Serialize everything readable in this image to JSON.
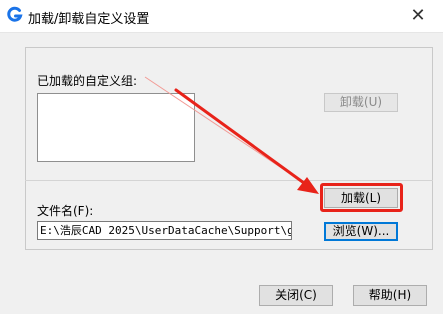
{
  "window": {
    "title": "加载/卸载自定义设置",
    "close_glyph": "✕",
    "icon": "app-logo-icon",
    "accent_color": "#1a73e8"
  },
  "groups": {
    "loaded_label": "已加载的自定义组:",
    "unload_button": "卸载(U)",
    "load_button": "加载(L)",
    "filename_label": "文件名(F):",
    "filename_value": "E:\\浩辰CAD 2025\\UserDataCache\\Support\\gc",
    "browse_button": "浏览(W)..."
  },
  "footer": {
    "close_button": "关闭(C)",
    "help_button": "帮助(H)"
  },
  "annotation": {
    "color": "#e8231a"
  }
}
